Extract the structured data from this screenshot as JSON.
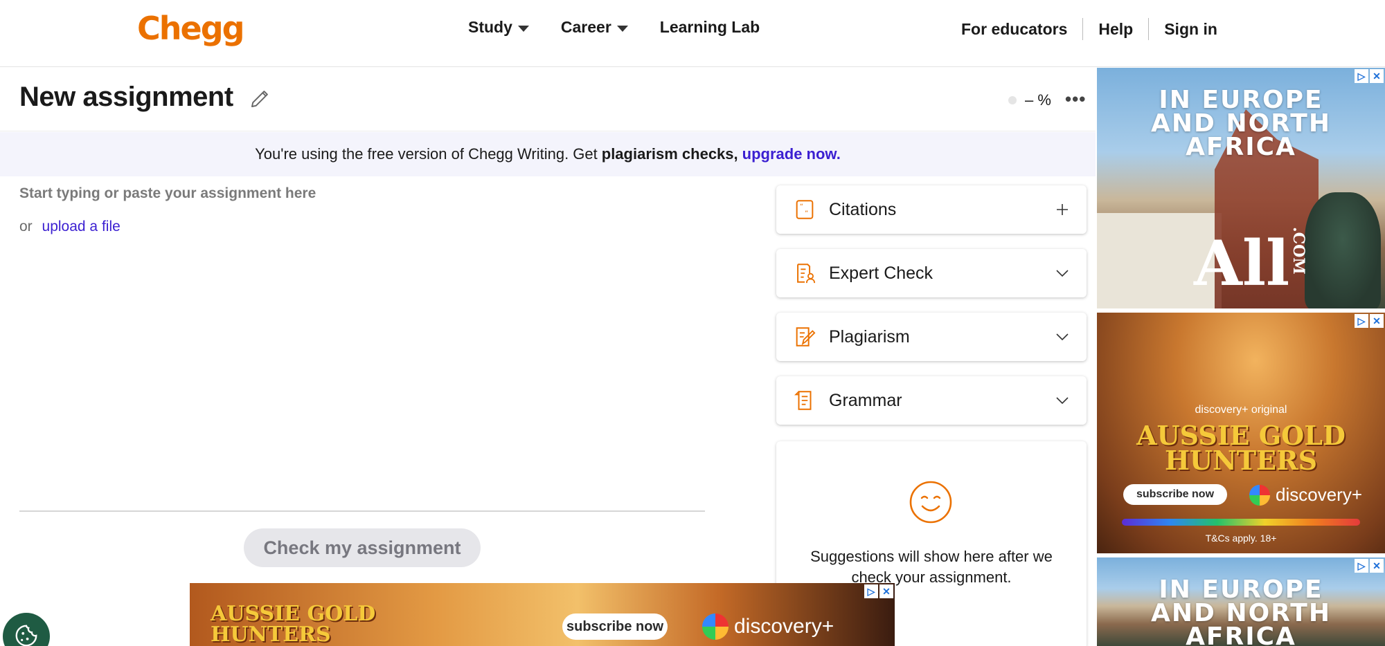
{
  "header": {
    "logo": "Chegg",
    "nav": [
      {
        "label": "Study",
        "has_dropdown": true
      },
      {
        "label": "Career",
        "has_dropdown": true
      },
      {
        "label": "Learning Lab",
        "has_dropdown": false
      }
    ],
    "right_nav": [
      "For educators",
      "Help",
      "Sign in"
    ]
  },
  "document": {
    "title": "New assignment",
    "score_text": "– %"
  },
  "banner": {
    "prefix": "You're using the free version of Chegg Writing. Get",
    "bold": "plagiarism checks,",
    "link": "upgrade now."
  },
  "editor": {
    "placeholder": "Start typing or paste your assignment here",
    "or_text": "or",
    "upload_link": "upload a file",
    "check_button": "Check my assignment"
  },
  "side_panels": [
    {
      "label": "Citations",
      "icon": "citation-icon",
      "toggle": "plus"
    },
    {
      "label": "Expert Check",
      "icon": "expert-check-icon",
      "toggle": "chevron-down"
    },
    {
      "label": "Plagiarism",
      "icon": "plagiarism-icon",
      "toggle": "chevron-down"
    },
    {
      "label": "Grammar",
      "icon": "grammar-icon",
      "toggle": "chevron-down"
    }
  ],
  "suggestions": {
    "icon": "smiley-icon",
    "text": "Suggestions will show here after we check your assignment."
  },
  "ads": {
    "europe": {
      "headline_lines": [
        "IN EUROPE",
        "AND NORTH",
        "AFRICA"
      ],
      "brand": "All",
      "brand_suffix": ".COM"
    },
    "gold": {
      "tag": "discovery+ original",
      "title_lines": [
        "AUSSIE GOLD",
        "HUNTERS"
      ],
      "cta": "subscribe now",
      "brand": "discovery+",
      "terms": "T&Cs apply. 18+"
    }
  },
  "colors": {
    "brand_orange": "#eb7100",
    "link_purple": "#3b1fd1",
    "cookie_green": "#1f5b43"
  }
}
